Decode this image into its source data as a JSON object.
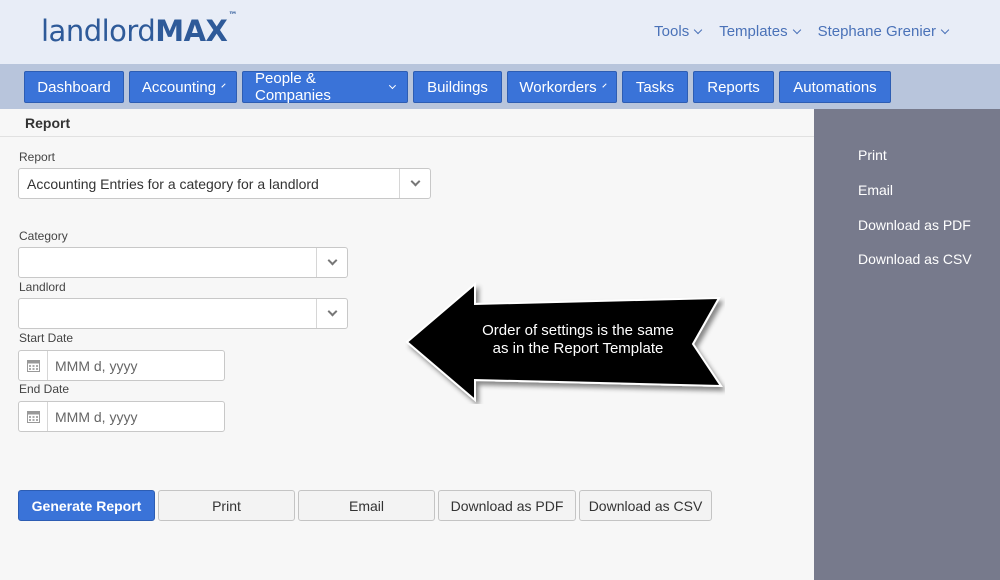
{
  "header": {
    "logo_thin": "landlord",
    "logo_bold": "MAX",
    "logo_tm": "™",
    "links": [
      {
        "label": "Tools"
      },
      {
        "label": "Templates"
      },
      {
        "label": "Stephane Grenier"
      }
    ]
  },
  "nav": {
    "items": [
      {
        "label": "Dashboard",
        "dropdown": false
      },
      {
        "label": "Accounting",
        "dropdown": true
      },
      {
        "label": "People & Companies",
        "dropdown": true
      },
      {
        "label": "Buildings",
        "dropdown": false
      },
      {
        "label": "Workorders",
        "dropdown": true
      },
      {
        "label": "Tasks",
        "dropdown": false
      },
      {
        "label": "Reports",
        "dropdown": false
      },
      {
        "label": "Automations",
        "dropdown": false
      }
    ]
  },
  "main": {
    "section_title": "Report",
    "report_label": "Report",
    "report_value": "Accounting Entries for a category for a landlord",
    "category_label": "Category",
    "category_value": "",
    "landlord_label": "Landlord",
    "landlord_value": "",
    "start_date_label": "Start Date",
    "start_date_placeholder": "MMM d, yyyy",
    "end_date_label": "End Date",
    "end_date_placeholder": "MMM d, yyyy"
  },
  "buttons": {
    "generate": "Generate Report",
    "print": "Print",
    "email": "Email",
    "download_pdf": "Download as PDF",
    "download_csv": "Download as CSV"
  },
  "sidebar": {
    "items": [
      {
        "label": "Print"
      },
      {
        "label": "Email"
      },
      {
        "label": "Download as PDF"
      },
      {
        "label": "Download as CSV"
      }
    ]
  },
  "callout": {
    "line1": "Order of settings is the same",
    "line2": "as in the Report Template"
  },
  "colors": {
    "brand": "#2e5a99",
    "primary": "#3a73d8",
    "nav_bar": "#b8c5dc",
    "sidebar": "#777a8c"
  }
}
